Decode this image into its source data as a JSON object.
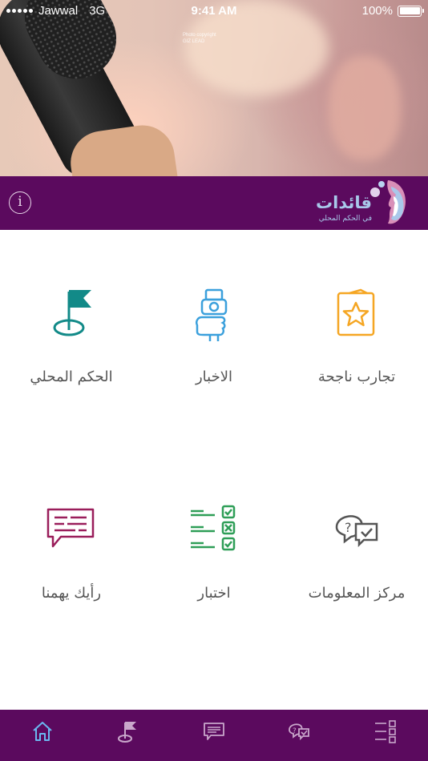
{
  "status_bar": {
    "carrier": "Jawwal",
    "network": "3G",
    "time": "9:41 AM",
    "battery": "100%"
  },
  "hero": {
    "copyright": "Photo copyright\nGIZ LEAD"
  },
  "header": {
    "info_icon": "info-icon",
    "logo_title": "قائدات",
    "logo_subtitle": "في الحكم المحلي"
  },
  "grid": {
    "items": [
      {
        "label": "تجارب ناجحة",
        "icon": "star-card-icon",
        "color": "#f5a623"
      },
      {
        "label": "الاخبار",
        "icon": "microphone-icon",
        "color": "#3ba0dc"
      },
      {
        "label": "الحكم المحلي",
        "icon": "flag-icon",
        "color": "#128a88"
      },
      {
        "label": "مركز المعلومات",
        "icon": "faq-chat-icon",
        "color": "#555555"
      },
      {
        "label": "اختبار",
        "icon": "checklist-icon",
        "color": "#2e9e57"
      },
      {
        "label": "رأيك يهمنا",
        "icon": "feedback-chat-icon",
        "color": "#9a1e5b"
      }
    ]
  },
  "tab_bar": {
    "tabs": [
      {
        "name": "home-icon",
        "active": true
      },
      {
        "name": "flag-icon",
        "active": false
      },
      {
        "name": "feedback-icon",
        "active": false
      },
      {
        "name": "faq-icon",
        "active": false
      },
      {
        "name": "checklist-icon",
        "active": false
      }
    ],
    "active_color": "#6ab8f0",
    "inactive_color": "#c9a7cb"
  },
  "colors": {
    "header_bg": "#5b0a5e",
    "tab_bg": "#5b0a5e"
  }
}
